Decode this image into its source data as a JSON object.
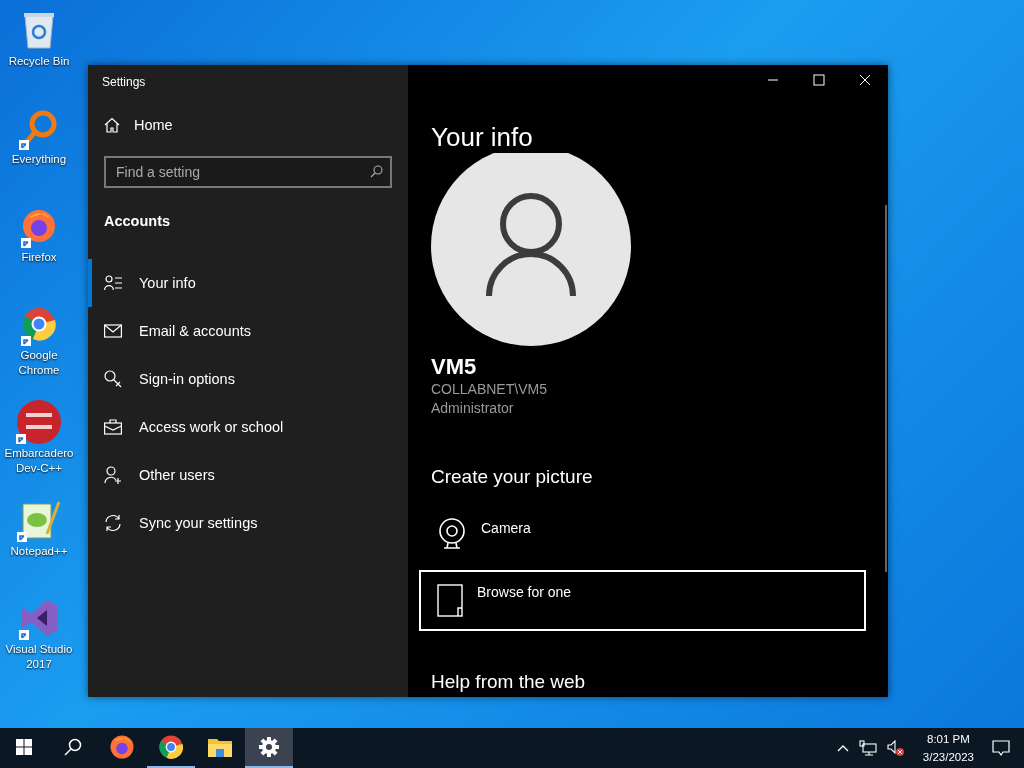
{
  "desktop_icons": [
    {
      "label": "Recycle Bin",
      "kind": "recycle",
      "shortcut": false
    },
    {
      "label": "Everything",
      "kind": "everything",
      "shortcut": true
    },
    {
      "label": "Firefox",
      "kind": "firefox",
      "shortcut": true
    },
    {
      "label": "Google Chrome",
      "kind": "chrome",
      "shortcut": true
    },
    {
      "label": "Embarcadero Dev-C++",
      "kind": "devcpp",
      "shortcut": true
    },
    {
      "label": "Notepad++",
      "kind": "notepad",
      "shortcut": true
    },
    {
      "label": "Visual Studio 2017",
      "kind": "vs",
      "shortcut": true
    }
  ],
  "window": {
    "title": "Settings",
    "sidebar": {
      "home": "Home",
      "search": {
        "placeholder": "Find a setting"
      },
      "section": "Accounts",
      "items": [
        {
          "label": "Your info",
          "kind": "info",
          "selected": true
        },
        {
          "label": "Email & accounts",
          "kind": "mail",
          "selected": false
        },
        {
          "label": "Sign-in options",
          "kind": "key",
          "selected": false
        },
        {
          "label": "Access work or school",
          "kind": "briefcase",
          "selected": false
        },
        {
          "label": "Other users",
          "kind": "adduser",
          "selected": false
        },
        {
          "label": "Sync your settings",
          "kind": "sync",
          "selected": false
        }
      ]
    },
    "content": {
      "heading": "Your info",
      "user": {
        "name": "VM5",
        "account": "COLLABNET\\VM5",
        "role": "Administrator"
      },
      "picture_heading": "Create your picture",
      "options": [
        {
          "label": "Camera",
          "kind": "camera",
          "selected": false
        },
        {
          "label": "Browse for one",
          "kind": "browse",
          "selected": true
        }
      ],
      "help_heading": "Help from the web"
    }
  },
  "taskbar": {
    "items": [
      {
        "kind": "start",
        "running": false,
        "selected": false
      },
      {
        "kind": "search",
        "running": false,
        "selected": false
      },
      {
        "kind": "firefox",
        "running": false,
        "selected": false
      },
      {
        "kind": "chrome",
        "running": true,
        "selected": false
      },
      {
        "kind": "explorer",
        "running": false,
        "selected": false
      },
      {
        "kind": "settings",
        "running": true,
        "selected": true
      }
    ],
    "tray": {
      "volume_muted": true,
      "time": "8:01 PM",
      "date": "3/23/2023"
    }
  }
}
